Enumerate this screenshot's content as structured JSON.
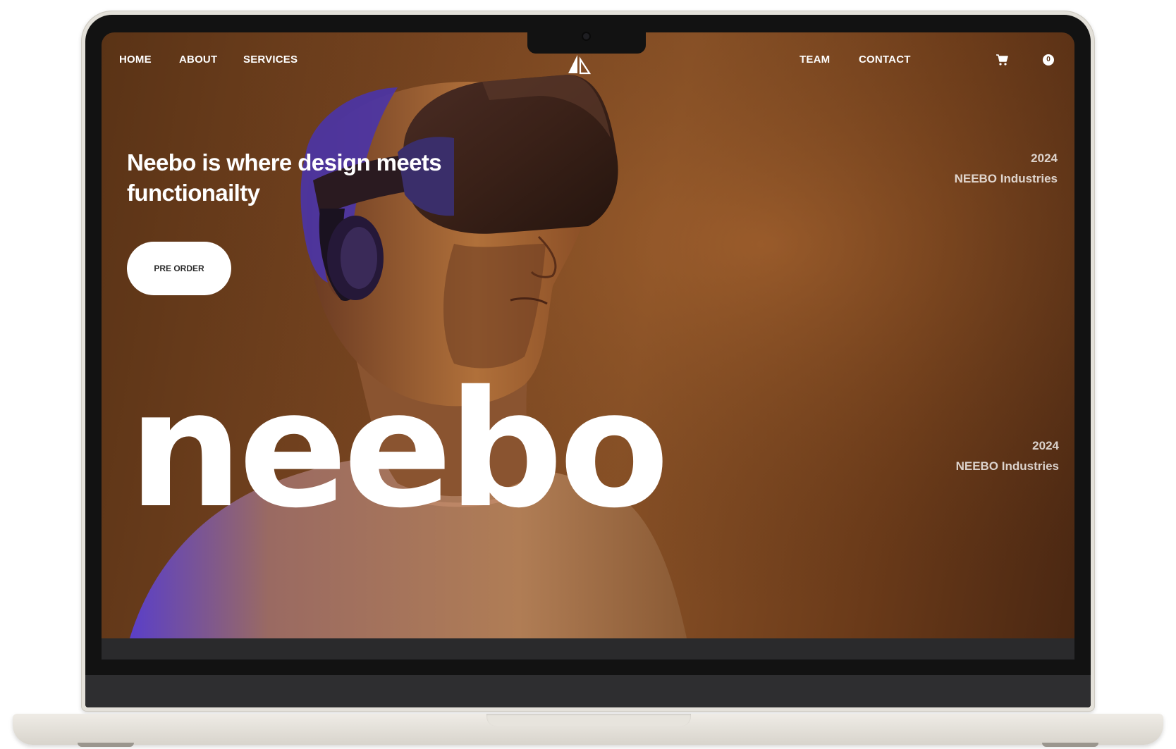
{
  "nav": {
    "left_links": [
      "HOME",
      "ABOUT",
      "SERVICES"
    ],
    "right_links": [
      "TEAM",
      "CONTACT"
    ],
    "cart_count": "0"
  },
  "hero": {
    "headline": "Neebo is where design meets functionailty",
    "cta_label": "PRE ORDER",
    "brand_word": "neebo"
  },
  "meta_top": {
    "year": "2024",
    "company": "NEEBO Industries"
  },
  "meta_bottom": {
    "year": "2024",
    "company": "NEEBO Industries"
  },
  "colors": {
    "background_warm": "#7a4621",
    "accent_purple": "#5a3fd0",
    "text": "#ffffff"
  }
}
